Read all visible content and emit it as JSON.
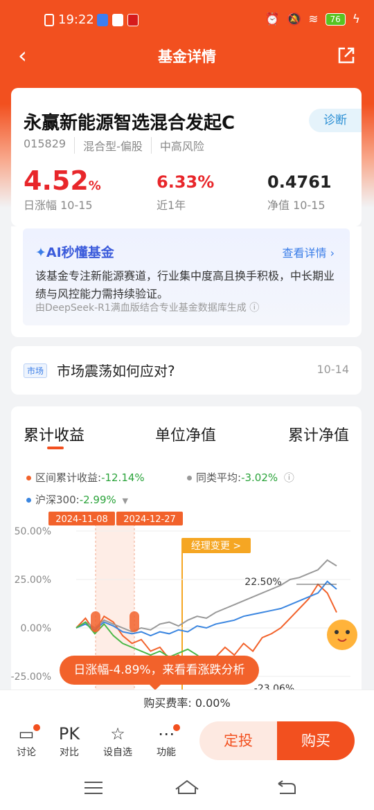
{
  "status": {
    "time": "19:22",
    "battery": "76"
  },
  "nav": {
    "title": "基金详情"
  },
  "fund": {
    "name": "永赢新能源智选混合发起C",
    "diagnose": "诊断",
    "code": "015829",
    "type": "混合型-偏股",
    "risk": "中高风险",
    "daily_value": "4.52",
    "daily_unit": "%",
    "daily_label": "日涨幅 10-15",
    "year_value": "6.33%",
    "year_label": "近1年",
    "nav_value": "0.4761",
    "nav_label": "净值 10-15"
  },
  "ai": {
    "title": "AI秒懂基金",
    "link": "查看详情 ›",
    "text": "该基金专注新能源赛道，行业集中度高且换手积极，中长期业绩与风控能力需持续验证。",
    "footer": "由DeepSeek-R1满血版结合专业基金数据库生成 ⓘ"
  },
  "news": {
    "tag": "市场",
    "text": "市场震荡如何应对?",
    "date": "10-14"
  },
  "chart_tabs": [
    "累计收益",
    "单位净值",
    "累计净值"
  ],
  "legend": {
    "fund_label": "区间累计收益:",
    "fund_value": "-12.14%",
    "peer_label": "同类平均:",
    "peer_value": "-3.02%",
    "index_label": "沪深300:",
    "index_value": "-2.99%"
  },
  "markers": {
    "date1": "2024-11-08",
    "date2": "2024-12-27",
    "manager": "经理变更 >",
    "peak": "22.50%",
    "low": "-23.06%"
  },
  "chart_data": {
    "type": "line",
    "ylim": [
      -25,
      50
    ],
    "yticks": [
      "50.00%",
      "25.00%",
      "0.00%",
      "-25.00%"
    ],
    "series": [
      {
        "name": "区间累计收益",
        "color": "#f2622b",
        "values": [
          0,
          5,
          -2,
          6,
          3,
          -4,
          -8,
          -6,
          -12,
          -10,
          -16,
          -14,
          -20,
          -18,
          -23,
          -15,
          -10,
          -14,
          -8,
          -12,
          -5,
          -3,
          0,
          5,
          10,
          15,
          22.5,
          18,
          8
        ]
      },
      {
        "name": "同类平均",
        "color": "#999999",
        "values": [
          0,
          3,
          0,
          4,
          2,
          0,
          -2,
          0,
          -1,
          2,
          3,
          1,
          4,
          6,
          5,
          8,
          10,
          12,
          14,
          16,
          18,
          20,
          22,
          25,
          26,
          28,
          30,
          35,
          32
        ]
      },
      {
        "name": "沪深300",
        "color": "#3b86e0",
        "values": [
          0,
          2,
          -1,
          3,
          1,
          -2,
          -3,
          -2,
          -4,
          -2,
          -3,
          -1,
          -2,
          1,
          0,
          2,
          3,
          4,
          6,
          7,
          8,
          9,
          10,
          12,
          14,
          16,
          18,
          24,
          20
        ]
      },
      {
        "name": "green",
        "color": "#4cb848",
        "values": [
          0,
          3,
          -3,
          2,
          -4,
          -8,
          -10,
          -12,
          -14,
          -12,
          -15,
          -13,
          -11,
          -14,
          -18
        ]
      }
    ]
  },
  "toast": "日涨幅-4.89%，来看看涨跌分析",
  "fee": "购买费率: 0.00%",
  "bottom": {
    "discuss": "讨论",
    "pk": "PK",
    "compare": "对比",
    "watch": "设自选",
    "func": "功能",
    "dingtou": "定投",
    "buy": "购买"
  }
}
